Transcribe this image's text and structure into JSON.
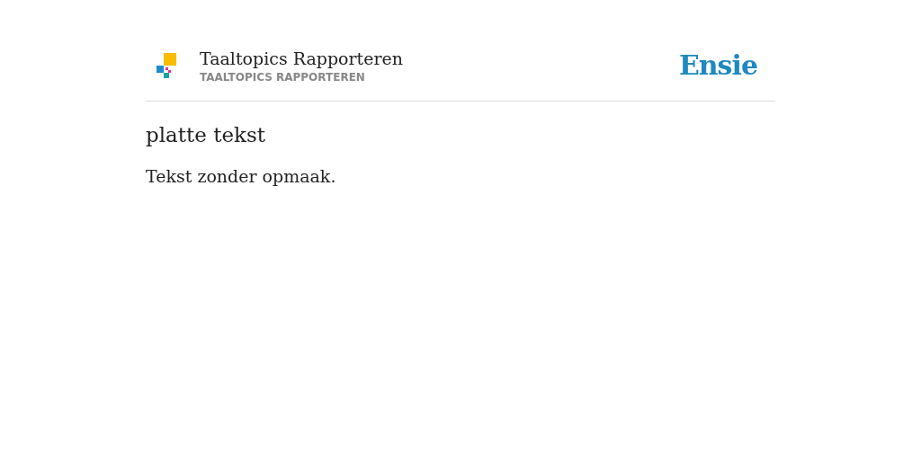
{
  "header": {
    "title": "Taaltopics Rapporteren",
    "subtitle": "TAALTOPICS RAPPORTEREN",
    "brand": "Ensie"
  },
  "article": {
    "heading": "platte tekst",
    "body": "Tekst zonder opmaak."
  }
}
